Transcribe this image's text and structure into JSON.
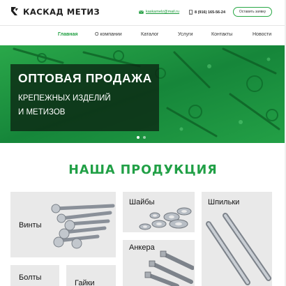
{
  "header": {
    "logo_text": "КАСКАД МЕТИЗ",
    "email": "kaskamelz@mail.ru",
    "phone": "8 (916) 165-56-24",
    "callback_label": "Оставить заявку"
  },
  "nav": {
    "items": [
      {
        "label": "Главная",
        "active": true
      },
      {
        "label": "О компании"
      },
      {
        "label": "Каталог"
      },
      {
        "label": "Услуги"
      },
      {
        "label": "Контакты"
      },
      {
        "label": "Новости"
      }
    ]
  },
  "hero": {
    "title": "ОПТОВАЯ ПРОДАЖА",
    "subtitle_line1": "КРЕПЕЖНЫХ ИЗДЕЛИЙ",
    "subtitle_line2": "И МЕТИЗОВ",
    "slides_total": 2,
    "active_slide": 1
  },
  "products": {
    "heading": "НАША ПРОДУКЦИЯ",
    "items": [
      {
        "label": "Винты"
      },
      {
        "label": "Шайбы"
      },
      {
        "label": "Шпильки"
      },
      {
        "label": "Анкера"
      },
      {
        "label": "Болты"
      },
      {
        "label": "Гайки"
      }
    ]
  },
  "colors": {
    "accent": "#21a046",
    "hero_green": "#1b8a3a",
    "card_bg": "#e9e9e9"
  }
}
